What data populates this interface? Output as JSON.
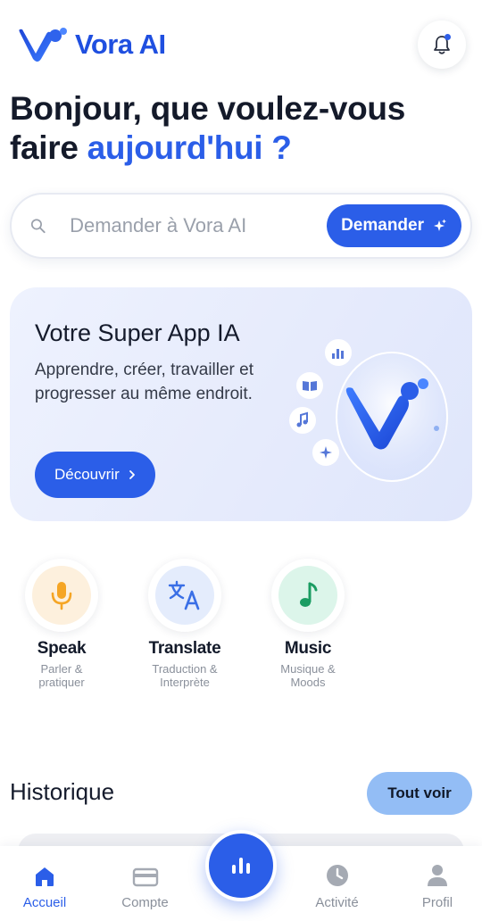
{
  "app": {
    "name": "Vora AI",
    "brand_color": "#2b5ee8"
  },
  "header": {
    "logo_text": "Vora AI",
    "bell_icon": "bell-icon"
  },
  "greeting": {
    "line1": "Bonjour, que voulez-vous",
    "line2_plain": "faire ",
    "line2_accent": "aujourd'hui ?"
  },
  "search": {
    "placeholder": "Demander à Vora AI",
    "value": "",
    "button_label": "Demander"
  },
  "hero": {
    "title": "Votre Super App IA",
    "description": "Apprendre, créer, travailler et progresser au même endroit.",
    "button_label": "Découvrir"
  },
  "quick_actions": [
    {
      "title": "Speak",
      "subtitle": "Parler &\npratiquer",
      "icon": "microphone-icon",
      "bg": "#fdf0dd"
    },
    {
      "title": "Translate",
      "subtitle": "Traduction &\nInterprète",
      "icon": "translate-icon",
      "bg": "#e4ecfc"
    },
    {
      "title": "Music",
      "subtitle": "Musique &\nMoods",
      "icon": "music-note-icon",
      "bg": "#dcf5ea"
    }
  ],
  "history": {
    "title": "Historique",
    "see_all_label": "Tout voir"
  },
  "bottom_nav": [
    {
      "label": "Accueil",
      "icon": "home-icon",
      "active": true
    },
    {
      "label": "Compte",
      "icon": "card-icon",
      "active": false
    },
    {
      "label": "Activité",
      "icon": "clock-icon",
      "active": false
    },
    {
      "label": "Profil",
      "icon": "user-icon",
      "active": false
    }
  ]
}
